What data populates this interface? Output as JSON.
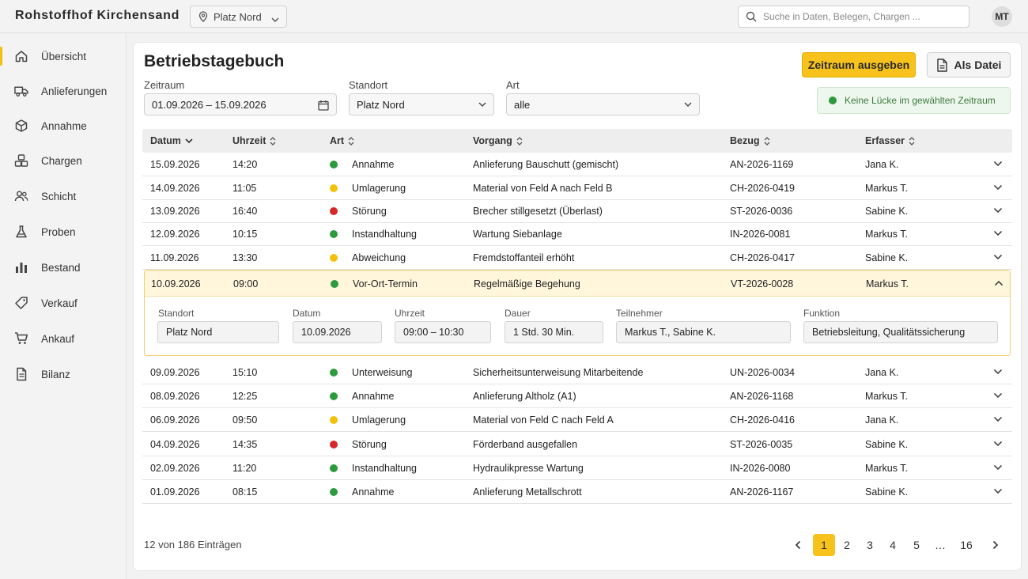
{
  "app": {
    "title": "Rohstoffhof Kirchensand"
  },
  "location_selector": {
    "value": "Platz Nord"
  },
  "search": {
    "placeholder": "Suche in Daten, Belegen, Chargen ..."
  },
  "user": {
    "initials": "MT"
  },
  "sidebar": {
    "items": [
      {
        "label": "Übersicht",
        "icon": "home-icon",
        "active": true
      },
      {
        "label": "Anlieferungen",
        "icon": "truck-icon"
      },
      {
        "label": "Annahme",
        "icon": "package-icon"
      },
      {
        "label": "Chargen",
        "icon": "batches-icon"
      },
      {
        "label": "Schicht",
        "icon": "users-icon"
      },
      {
        "label": "Proben",
        "icon": "flask-icon"
      },
      {
        "label": "Bestand",
        "icon": "bar-chart-icon"
      },
      {
        "label": "Verkauf",
        "icon": "tag-icon"
      },
      {
        "label": "Ankauf",
        "icon": "cart-icon"
      },
      {
        "label": "Bilanz",
        "icon": "document-icon"
      }
    ]
  },
  "page": {
    "title": "Betriebstagebuch",
    "export_button": "Zeitraum ausgeben",
    "file_button": "Als Datei",
    "status": "Keine Lücke im gewählten Zeitraum"
  },
  "filters": {
    "zeitraum_label": "Zeitraum",
    "zeitraum_value": "01.09.2026 – 15.09.2026",
    "standort_label": "Standort",
    "standort_value": "Platz Nord",
    "art_label": "Art",
    "art_value": "alle"
  },
  "table": {
    "columns": [
      "Datum",
      "Uhrzeit",
      "Art",
      "Vorgang",
      "Bezug",
      "Erfasser"
    ],
    "rows": [
      {
        "datum": "15.09.2026",
        "uhrzeit": "14:20",
        "art": "Annahme",
        "status": "green",
        "vorgang": "Anlieferung Bauschutt (gemischt)",
        "bezug": "AN-2026-1169",
        "erfasser": "Jana K."
      },
      {
        "datum": "14.09.2026",
        "uhrzeit": "11:05",
        "art": "Umlagerung",
        "status": "yellow",
        "vorgang": "Material von Feld A nach Feld B",
        "bezug": "CH-2026-0419",
        "erfasser": "Markus T."
      },
      {
        "datum": "13.09.2026",
        "uhrzeit": "16:40",
        "art": "Störung",
        "status": "red",
        "vorgang": "Brecher stillgesetzt (Überlast)",
        "bezug": "ST-2026-0036",
        "erfasser": "Sabine K."
      },
      {
        "datum": "12.09.2026",
        "uhrzeit": "10:15",
        "art": "Instandhaltung",
        "status": "green",
        "vorgang": "Wartung Siebanlage",
        "bezug": "IN-2026-0081",
        "erfasser": "Markus T."
      },
      {
        "datum": "11.09.2026",
        "uhrzeit": "13:30",
        "art": "Abweichung",
        "status": "yellow",
        "vorgang": "Fremdstoffanteil erhöht",
        "bezug": "CH-2026-0417",
        "erfasser": "Sabine K."
      },
      {
        "datum": "10.09.2026",
        "uhrzeit": "09:00",
        "art": "Vor-Ort-Termin",
        "status": "green",
        "vorgang": "Regelmäßige Begehung",
        "bezug": "VT-2026-0028",
        "erfasser": "Markus T.",
        "expanded": true
      },
      {
        "datum": "09.09.2026",
        "uhrzeit": "15:10",
        "art": "Unterweisung",
        "status": "green",
        "vorgang": "Sicherheitsunterweisung Mitarbeitende",
        "bezug": "UN-2026-0034",
        "erfasser": "Jana K."
      },
      {
        "datum": "08.09.2026",
        "uhrzeit": "12:25",
        "art": "Annahme",
        "status": "green",
        "vorgang": "Anlieferung Altholz (A1)",
        "bezug": "AN-2026-1168",
        "erfasser": "Markus T."
      },
      {
        "datum": "06.09.2026",
        "uhrzeit": "09:50",
        "art": "Umlagerung",
        "status": "yellow",
        "vorgang": "Material von Feld C nach Feld A",
        "bezug": "CH-2026-0416",
        "erfasser": "Jana K."
      },
      {
        "datum": "04.09.2026",
        "uhrzeit": "14:35",
        "art": "Störung",
        "status": "red",
        "vorgang": "Förderband ausgefallen",
        "bezug": "ST-2026-0035",
        "erfasser": "Sabine K."
      },
      {
        "datum": "02.09.2026",
        "uhrzeit": "11:20",
        "art": "Instandhaltung",
        "status": "green",
        "vorgang": "Hydraulikpresse Wartung",
        "bezug": "IN-2026-0080",
        "erfasser": "Markus T."
      },
      {
        "datum": "01.09.2026",
        "uhrzeit": "08:15",
        "art": "Annahme",
        "status": "green",
        "vorgang": "Anlieferung Metallschrott",
        "bezug": "AN-2026-1167",
        "erfasser": "Sabine K."
      }
    ]
  },
  "detail": {
    "standort_label": "Standort",
    "standort": "Platz Nord",
    "datum_label": "Datum",
    "datum": "10.09.2026",
    "uhrzeit_label": "Uhrzeit",
    "uhrzeit": "09:00 – 10:30",
    "dauer_label": "Dauer",
    "dauer": "1 Std. 30 Min.",
    "teilnehmer_label": "Teilnehmer",
    "teilnehmer": "Markus T., Sabine K.",
    "funktion_label": "Funktion",
    "funktion": "Betriebsleitung, Qualitätssicherung"
  },
  "footer": {
    "count": "12 von 186 Einträgen",
    "pages": [
      "1",
      "2",
      "3",
      "4",
      "5",
      "…",
      "16"
    ],
    "current_page": "1"
  },
  "colors": {
    "accent": "#f6c21b",
    "green": "#2e9a3e",
    "yellow": "#f2c10f",
    "red": "#d62828"
  }
}
